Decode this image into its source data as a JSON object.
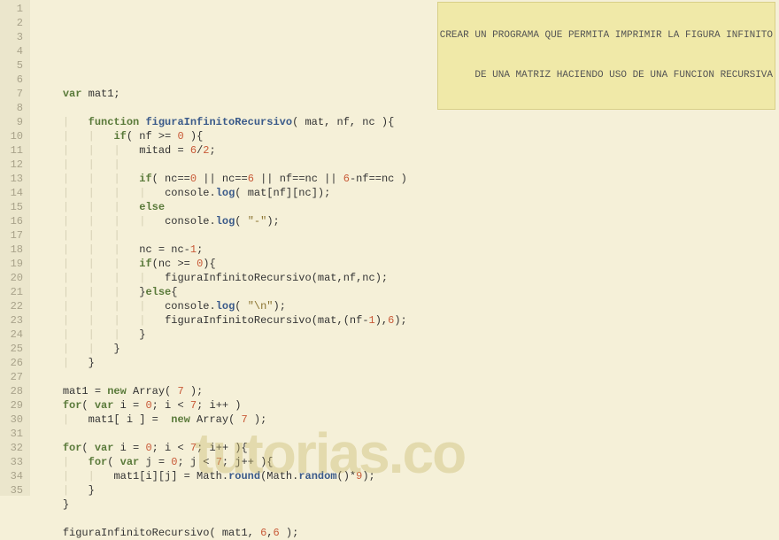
{
  "watermark": "tutorias.co",
  "comment": {
    "line1": "CREAR UN PROGRAMA QUE PERMITA IMPRIMIR LA FIGURA INFINITO",
    "line2": "DE UNA MATRIZ HACIENDO USO DE UNA FUNCION RECURSIVA"
  },
  "lines": [
    {
      "n": 1,
      "tokens": []
    },
    {
      "n": 2,
      "tokens": []
    },
    {
      "n": 3,
      "tokens": []
    },
    {
      "n": 4,
      "indent": 1,
      "tokens": [
        {
          "t": "var",
          "c": "kw"
        },
        {
          "t": " mat1;",
          "c": "id"
        }
      ]
    },
    {
      "n": 5,
      "indent": 1,
      "tokens": []
    },
    {
      "n": 6,
      "indent": 2,
      "tokens": [
        {
          "t": "function",
          "c": "kw"
        },
        {
          "t": " ",
          "c": ""
        },
        {
          "t": "figuraInfinitoRecursivo",
          "c": "fn"
        },
        {
          "t": "( mat, nf, nc ){",
          "c": "id"
        }
      ]
    },
    {
      "n": 7,
      "indent": 3,
      "tokens": [
        {
          "t": "if",
          "c": "kw"
        },
        {
          "t": "( nf ",
          "c": "id"
        },
        {
          "t": ">=",
          "c": "op"
        },
        {
          "t": " ",
          "c": ""
        },
        {
          "t": "0",
          "c": "num"
        },
        {
          "t": " ){",
          "c": "id"
        }
      ]
    },
    {
      "n": 8,
      "indent": 4,
      "tokens": [
        {
          "t": "mitad ",
          "c": "id"
        },
        {
          "t": "=",
          "c": "op"
        },
        {
          "t": " ",
          "c": ""
        },
        {
          "t": "6",
          "c": "num"
        },
        {
          "t": "/",
          "c": "op"
        },
        {
          "t": "2",
          "c": "num"
        },
        {
          "t": ";",
          "c": "id"
        }
      ]
    },
    {
      "n": 9,
      "indent": 4,
      "tokens": []
    },
    {
      "n": 10,
      "indent": 4,
      "tokens": [
        {
          "t": "if",
          "c": "kw"
        },
        {
          "t": "( nc",
          "c": "id"
        },
        {
          "t": "==",
          "c": "op"
        },
        {
          "t": "0",
          "c": "num"
        },
        {
          "t": " ",
          "c": ""
        },
        {
          "t": "||",
          "c": "op"
        },
        {
          "t": " nc",
          "c": "id"
        },
        {
          "t": "==",
          "c": "op"
        },
        {
          "t": "6",
          "c": "num"
        },
        {
          "t": " ",
          "c": ""
        },
        {
          "t": "||",
          "c": "op"
        },
        {
          "t": " nf",
          "c": "id"
        },
        {
          "t": "==",
          "c": "op"
        },
        {
          "t": "nc ",
          "c": "id"
        },
        {
          "t": "||",
          "c": "op"
        },
        {
          "t": " ",
          "c": ""
        },
        {
          "t": "6",
          "c": "num"
        },
        {
          "t": "-",
          "c": "op"
        },
        {
          "t": "nf",
          "c": "id"
        },
        {
          "t": "==",
          "c": "op"
        },
        {
          "t": "nc )",
          "c": "id"
        }
      ]
    },
    {
      "n": 11,
      "indent": 5,
      "tokens": [
        {
          "t": "console",
          "c": "id"
        },
        {
          "t": ".",
          "c": "dot"
        },
        {
          "t": "log",
          "c": "fn"
        },
        {
          "t": "( mat[nf][nc]);",
          "c": "id"
        }
      ]
    },
    {
      "n": 12,
      "indent": 4,
      "tokens": [
        {
          "t": "else",
          "c": "kw"
        }
      ]
    },
    {
      "n": 13,
      "indent": 5,
      "tokens": [
        {
          "t": "console",
          "c": "id"
        },
        {
          "t": ".",
          "c": "dot"
        },
        {
          "t": "log",
          "c": "fn"
        },
        {
          "t": "( ",
          "c": "id"
        },
        {
          "t": "\"-\"",
          "c": "str"
        },
        {
          "t": ");",
          "c": "id"
        }
      ]
    },
    {
      "n": 14,
      "indent": 4,
      "tokens": []
    },
    {
      "n": 15,
      "indent": 4,
      "tokens": [
        {
          "t": "nc ",
          "c": "id"
        },
        {
          "t": "=",
          "c": "op"
        },
        {
          "t": " nc",
          "c": "id"
        },
        {
          "t": "-",
          "c": "op"
        },
        {
          "t": "1",
          "c": "num"
        },
        {
          "t": ";",
          "c": "id"
        }
      ]
    },
    {
      "n": 16,
      "indent": 4,
      "tokens": [
        {
          "t": "if",
          "c": "kw"
        },
        {
          "t": "(nc ",
          "c": "id"
        },
        {
          "t": ">=",
          "c": "op"
        },
        {
          "t": " ",
          "c": ""
        },
        {
          "t": "0",
          "c": "num"
        },
        {
          "t": "){",
          "c": "id"
        }
      ]
    },
    {
      "n": 17,
      "indent": 5,
      "tokens": [
        {
          "t": "figuraInfinitoRecursivo(mat,nf,nc);",
          "c": "id"
        }
      ]
    },
    {
      "n": 18,
      "indent": 4,
      "tokens": [
        {
          "t": "}",
          "c": "id"
        },
        {
          "t": "else",
          "c": "kw"
        },
        {
          "t": "{",
          "c": "id"
        }
      ]
    },
    {
      "n": 19,
      "indent": 5,
      "tokens": [
        {
          "t": "console",
          "c": "id"
        },
        {
          "t": ".",
          "c": "dot"
        },
        {
          "t": "log",
          "c": "fn"
        },
        {
          "t": "( ",
          "c": "id"
        },
        {
          "t": "\"\\n\"",
          "c": "str"
        },
        {
          "t": ");",
          "c": "id"
        }
      ]
    },
    {
      "n": 20,
      "indent": 5,
      "tokens": [
        {
          "t": "figuraInfinitoRecursivo(mat,(nf",
          "c": "id"
        },
        {
          "t": "-",
          "c": "op"
        },
        {
          "t": "1",
          "c": "num"
        },
        {
          "t": "),",
          "c": "id"
        },
        {
          "t": "6",
          "c": "num"
        },
        {
          "t": ");",
          "c": "id"
        }
      ]
    },
    {
      "n": 21,
      "indent": 4,
      "tokens": [
        {
          "t": "}",
          "c": "id"
        }
      ]
    },
    {
      "n": 22,
      "indent": 3,
      "tokens": [
        {
          "t": "}",
          "c": "id"
        }
      ]
    },
    {
      "n": 23,
      "indent": 2,
      "tokens": [
        {
          "t": "}",
          "c": "id"
        }
      ]
    },
    {
      "n": 24,
      "indent": 0,
      "tokens": []
    },
    {
      "n": 25,
      "indent": 1,
      "tokens": [
        {
          "t": "mat1 ",
          "c": "id"
        },
        {
          "t": "=",
          "c": "op"
        },
        {
          "t": " ",
          "c": ""
        },
        {
          "t": "new",
          "c": "kw"
        },
        {
          "t": " Array( ",
          "c": "id"
        },
        {
          "t": "7",
          "c": "num"
        },
        {
          "t": " );",
          "c": "id"
        }
      ]
    },
    {
      "n": 26,
      "indent": 1,
      "tokens": [
        {
          "t": "for",
          "c": "kw"
        },
        {
          "t": "( ",
          "c": "id"
        },
        {
          "t": "var",
          "c": "kw"
        },
        {
          "t": " i ",
          "c": "id"
        },
        {
          "t": "=",
          "c": "op"
        },
        {
          "t": " ",
          "c": ""
        },
        {
          "t": "0",
          "c": "num"
        },
        {
          "t": "; i ",
          "c": "id"
        },
        {
          "t": "<",
          "c": "op"
        },
        {
          "t": " ",
          "c": ""
        },
        {
          "t": "7",
          "c": "num"
        },
        {
          "t": "; i",
          "c": "id"
        },
        {
          "t": "++",
          "c": "op"
        },
        {
          "t": " )",
          "c": "id"
        }
      ]
    },
    {
      "n": 27,
      "indent": 2,
      "tokens": [
        {
          "t": "mat1[ i ] ",
          "c": "id"
        },
        {
          "t": "=",
          "c": "op"
        },
        {
          "t": "  ",
          "c": ""
        },
        {
          "t": "new",
          "c": "kw"
        },
        {
          "t": " Array( ",
          "c": "id"
        },
        {
          "t": "7",
          "c": "num"
        },
        {
          "t": " );",
          "c": "id"
        }
      ]
    },
    {
      "n": 28,
      "indent": 0,
      "tokens": []
    },
    {
      "n": 29,
      "indent": 1,
      "tokens": [
        {
          "t": "for",
          "c": "kw"
        },
        {
          "t": "( ",
          "c": "id"
        },
        {
          "t": "var",
          "c": "kw"
        },
        {
          "t": " i ",
          "c": "id"
        },
        {
          "t": "=",
          "c": "op"
        },
        {
          "t": " ",
          "c": ""
        },
        {
          "t": "0",
          "c": "num"
        },
        {
          "t": "; i ",
          "c": "id"
        },
        {
          "t": "<",
          "c": "op"
        },
        {
          "t": " ",
          "c": ""
        },
        {
          "t": "7",
          "c": "num"
        },
        {
          "t": "; i",
          "c": "id"
        },
        {
          "t": "++",
          "c": "op"
        },
        {
          "t": " ){",
          "c": "id"
        }
      ]
    },
    {
      "n": 30,
      "indent": 2,
      "tokens": [
        {
          "t": "for",
          "c": "kw"
        },
        {
          "t": "( ",
          "c": "id"
        },
        {
          "t": "var",
          "c": "kw"
        },
        {
          "t": " j ",
          "c": "id"
        },
        {
          "t": "=",
          "c": "op"
        },
        {
          "t": " ",
          "c": ""
        },
        {
          "t": "0",
          "c": "num"
        },
        {
          "t": "; j ",
          "c": "id"
        },
        {
          "t": "<",
          "c": "op"
        },
        {
          "t": " ",
          "c": ""
        },
        {
          "t": "7",
          "c": "num"
        },
        {
          "t": "; j",
          "c": "id"
        },
        {
          "t": "++",
          "c": "op"
        },
        {
          "t": " ){",
          "c": "id"
        }
      ]
    },
    {
      "n": 31,
      "indent": 3,
      "tokens": [
        {
          "t": "mat1[i][j] ",
          "c": "id"
        },
        {
          "t": "=",
          "c": "op"
        },
        {
          "t": " Math",
          "c": "id"
        },
        {
          "t": ".",
          "c": "dot"
        },
        {
          "t": "round",
          "c": "fn"
        },
        {
          "t": "(Math",
          "c": "id"
        },
        {
          "t": ".",
          "c": "dot"
        },
        {
          "t": "random",
          "c": "fn"
        },
        {
          "t": "()",
          "c": "id"
        },
        {
          "t": "*",
          "c": "op"
        },
        {
          "t": "9",
          "c": "num"
        },
        {
          "t": ");",
          "c": "id"
        }
      ]
    },
    {
      "n": 32,
      "indent": 2,
      "tokens": [
        {
          "t": "}",
          "c": "id"
        }
      ]
    },
    {
      "n": 33,
      "indent": 1,
      "tokens": [
        {
          "t": "}",
          "c": "id"
        }
      ]
    },
    {
      "n": 34,
      "indent": 0,
      "tokens": []
    },
    {
      "n": 35,
      "indent": 1,
      "tokens": [
        {
          "t": "figuraInfinitoRecursivo( mat1, ",
          "c": "id"
        },
        {
          "t": "6",
          "c": "num"
        },
        {
          "t": ",",
          "c": "id"
        },
        {
          "t": "6",
          "c": "num"
        },
        {
          "t": " );",
          "c": "id"
        }
      ]
    }
  ]
}
